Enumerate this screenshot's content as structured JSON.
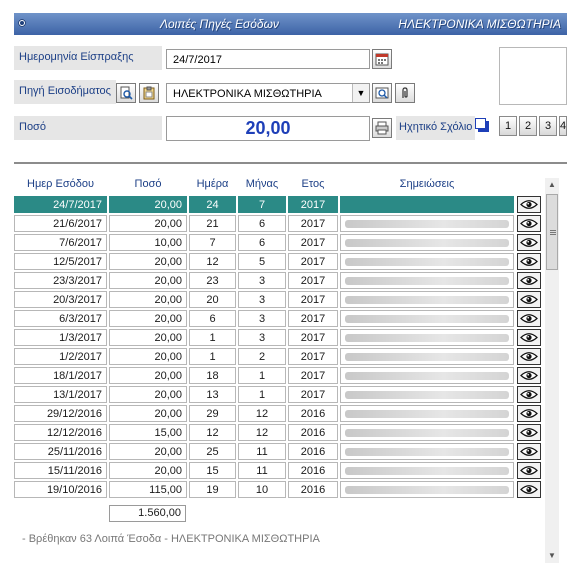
{
  "title": {
    "left": "Λοιπές Πηγές Εσόδων",
    "right": "ΗΛΕΚΤΡΟΝΙΚΑ ΜΙΣΘΩΤΗΡΙΑ"
  },
  "form": {
    "date_label": "Ημερομηνία Είσπραξης",
    "date_value": "24/7/2017",
    "source_label": "Πηγή Εισοδήματος",
    "source_value": "ΗΛΕΚΤΡΟΝΙΚΑ ΜΙΣΘΩΤΗΡΙΑ",
    "amount_label": "Ποσό",
    "amount_value": "20,00",
    "voice_label": "Ηχητικό Σχόλιο",
    "voice_buttons": [
      "1",
      "2",
      "3",
      "4"
    ]
  },
  "table": {
    "headers": [
      "Ημερ Εσόδου",
      "Ποσό",
      "Ημέρα",
      "Μήνας",
      "Ετος",
      "Σημειώσεις"
    ],
    "rows": [
      [
        "24/7/2017",
        "20,00",
        "24",
        "7",
        "2017"
      ],
      [
        "21/6/2017",
        "20,00",
        "21",
        "6",
        "2017"
      ],
      [
        "7/6/2017",
        "10,00",
        "7",
        "6",
        "2017"
      ],
      [
        "12/5/2017",
        "20,00",
        "12",
        "5",
        "2017"
      ],
      [
        "23/3/2017",
        "20,00",
        "23",
        "3",
        "2017"
      ],
      [
        "20/3/2017",
        "20,00",
        "20",
        "3",
        "2017"
      ],
      [
        "6/3/2017",
        "20,00",
        "6",
        "3",
        "2017"
      ],
      [
        "1/3/2017",
        "20,00",
        "1",
        "3",
        "2017"
      ],
      [
        "1/2/2017",
        "20,00",
        "1",
        "2",
        "2017"
      ],
      [
        "18/1/2017",
        "20,00",
        "18",
        "1",
        "2017"
      ],
      [
        "13/1/2017",
        "20,00",
        "13",
        "1",
        "2017"
      ],
      [
        "29/12/2016",
        "20,00",
        "29",
        "12",
        "2016"
      ],
      [
        "12/12/2016",
        "15,00",
        "12",
        "12",
        "2016"
      ],
      [
        "25/11/2016",
        "20,00",
        "25",
        "11",
        "2016"
      ],
      [
        "15/11/2016",
        "20,00",
        "15",
        "11",
        "2016"
      ],
      [
        "19/10/2016",
        "115,00",
        "19",
        "10",
        "2016"
      ]
    ],
    "selected_row": 0,
    "total": "1.560,00"
  },
  "footer": "- Βρέθηκαν  63 Λοιπά Έσοδα - ΗΛΕΚΤΡΟΝΙΚΑ ΜΙΣΘΩΤΗΡΙΑ",
  "icons": {
    "calendar": "calendar-icon",
    "search_doc": "search-document-icon",
    "clipboard": "clipboard-icon",
    "dropdown": "chevron-down-icon",
    "preview": "preview-icon",
    "attach": "paperclip-icon",
    "printer": "printer-icon",
    "view": "eye-icon"
  },
  "colors": {
    "title_bar": "#4a6fb0",
    "selected_row": "#2b8a86",
    "amount_text": "#1e3fb8",
    "label_text": "#1c3f86"
  }
}
